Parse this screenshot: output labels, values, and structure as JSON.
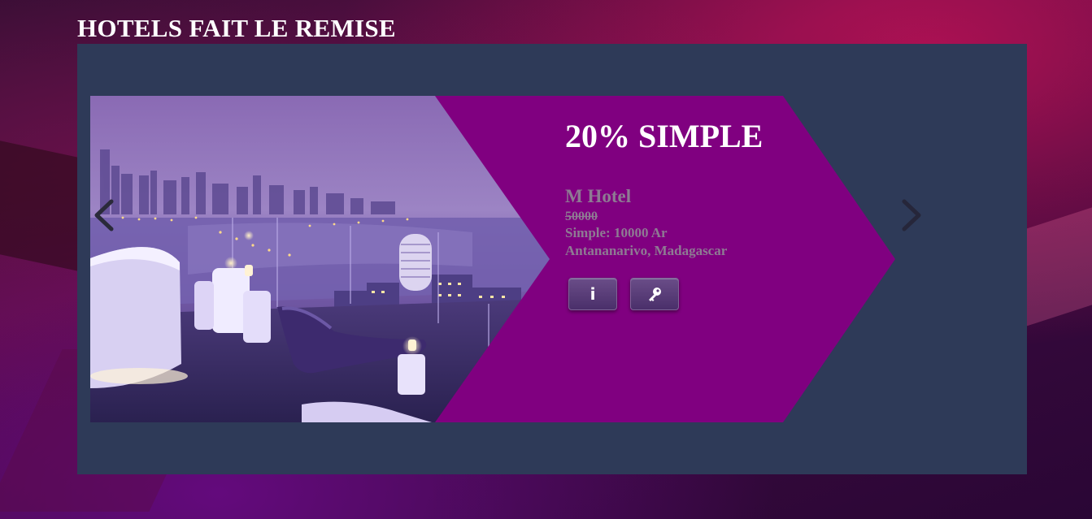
{
  "page": {
    "title": "HOTELS FAIT LE REMISE"
  },
  "slide": {
    "discount": "20% SIMPLE",
    "hotel_name": "M Hotel",
    "old_price": "50000",
    "room_price": "Simple: 10000 Ar",
    "location": "Antananarivo, Madagascar",
    "buttons": {
      "info_label": "i",
      "info_icon": "info-icon",
      "book_icon": "key-icon"
    }
  },
  "carousel": {
    "prev_icon": "chevron-left-icon",
    "next_icon": "chevron-right-icon"
  },
  "colors": {
    "panel": "#2e3a58",
    "arrow": "#800080",
    "text_muted": "#8e7b93",
    "text_white": "#ffffff"
  }
}
